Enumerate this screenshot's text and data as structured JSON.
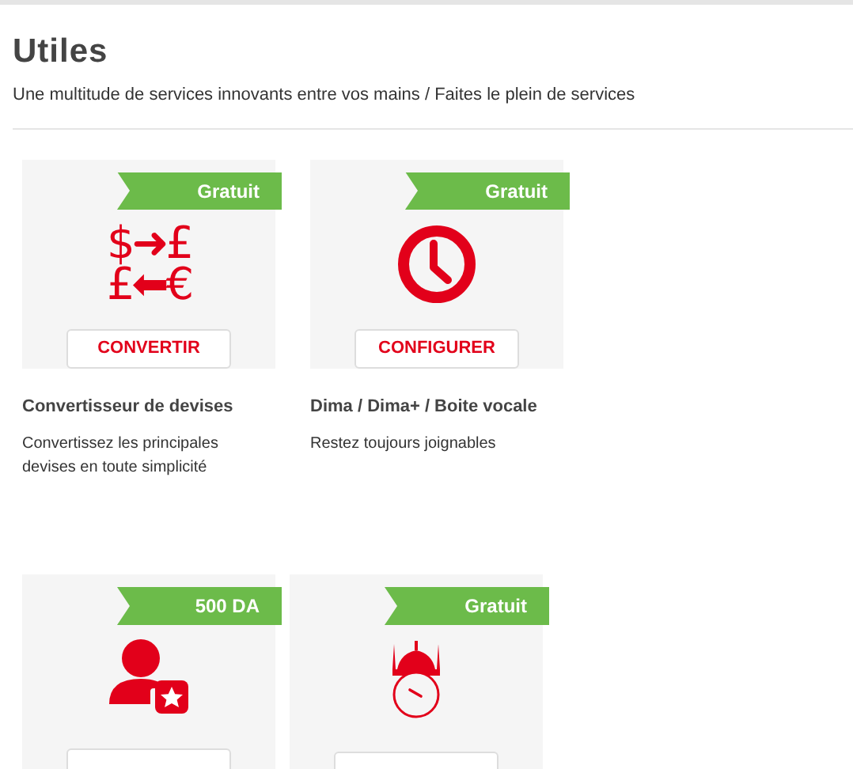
{
  "header": {
    "title": "Utiles",
    "subtitle": "Une multitude de services innovants entre vos mains / Faites le plein de services"
  },
  "rows": [
    {
      "cards": [
        {
          "kind": "currency",
          "icon_lines": [
            "$➜£",
            "£⬅€"
          ],
          "price": "Gratuit",
          "button": "CONVERTIR",
          "name": "Convertisseur de devises",
          "description": "Convertissez les principales devises en toute simplicité"
        },
        {
          "kind": "clock",
          "price": "Gratuit",
          "button": "CONFIGURER",
          "name": "Dima / Dima+ / Boite vocale",
          "description": "Restez toujours joignables"
        }
      ]
    },
    {
      "cards": [
        {
          "kind": "user-star",
          "price": "500 DA"
        },
        {
          "kind": "mosque-clock",
          "price": "Gratuit"
        }
      ]
    }
  ]
}
